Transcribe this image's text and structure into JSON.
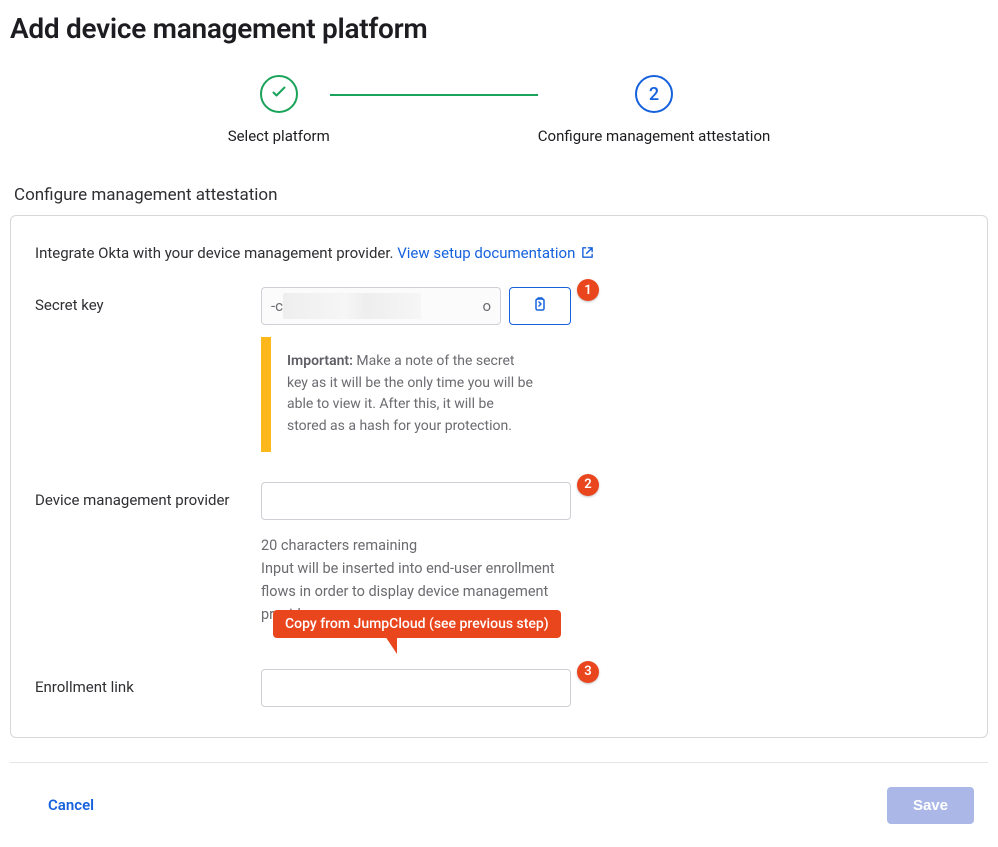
{
  "page": {
    "title": "Add device management platform"
  },
  "stepper": {
    "steps": [
      {
        "label": "Select platform",
        "done": true
      },
      {
        "label": "Configure management attestation",
        "number": "2",
        "active": true
      }
    ]
  },
  "section": {
    "heading": "Configure management attestation",
    "intro": "Integrate Okta with your device management provider.",
    "doc_link_text": "View setup documentation"
  },
  "fields": {
    "secret_key": {
      "label": "Secret key",
      "prefix": "-c",
      "suffix": "o",
      "copy_aria": "Copy to clipboard",
      "callout_strong": "Important:",
      "callout_text": " Make a note of the secret key as it will be the only time you will be able to view it. After this, it will be stored as a hash for your protection."
    },
    "provider": {
      "label": "Device management provider",
      "value": "",
      "helper_remaining": "20 characters remaining",
      "helper_desc": "Input will be inserted into end-user enrollment flows in order to display device management provider."
    },
    "enrollment_link": {
      "label": "Enrollment link",
      "value": ""
    }
  },
  "annotations": {
    "badge1": "1",
    "badge2": "2",
    "badge3": "3",
    "tooltip": "Copy from JumpCloud (see previous step)"
  },
  "footer": {
    "cancel": "Cancel",
    "save": "Save"
  }
}
